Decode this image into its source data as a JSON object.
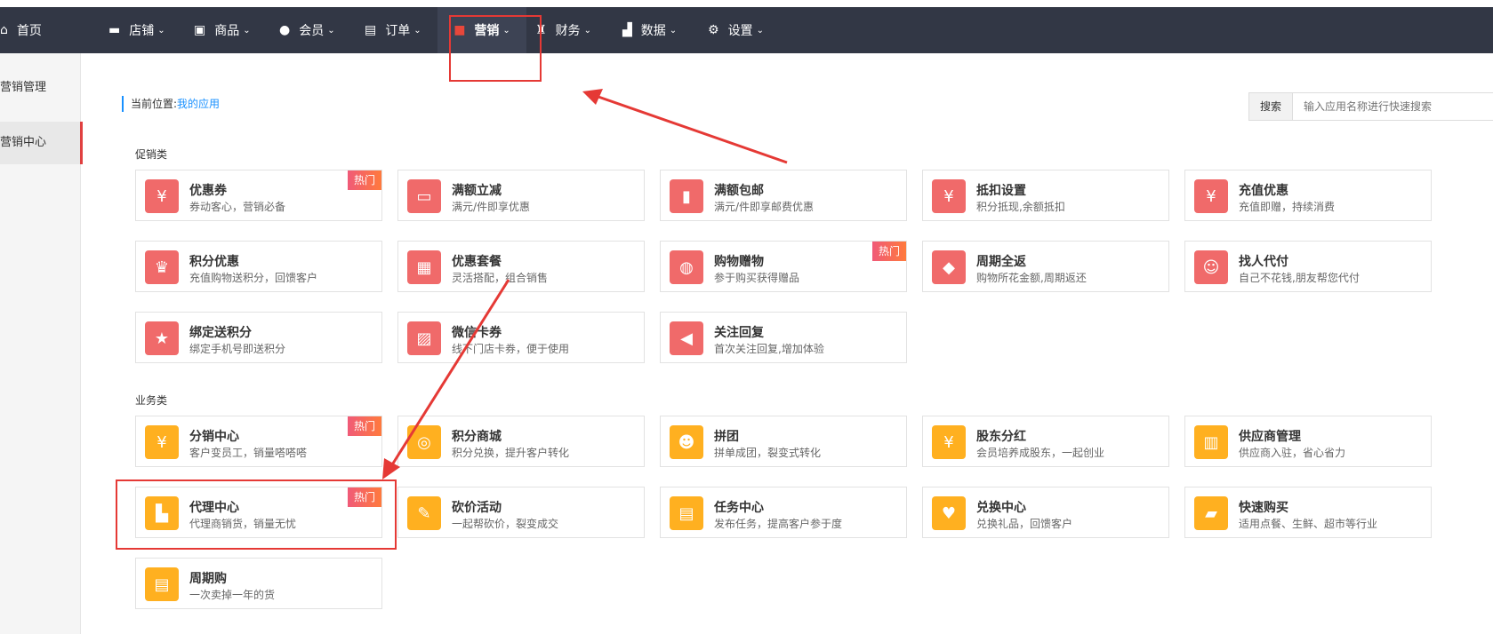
{
  "nav": {
    "items": [
      {
        "label": "首页",
        "icon": "home-icon",
        "glyph": "⌂"
      },
      {
        "label": "店铺",
        "icon": "store-icon",
        "glyph": "▬"
      },
      {
        "label": "商品",
        "icon": "goods-icon",
        "glyph": "▣"
      },
      {
        "label": "会员",
        "icon": "member-icon",
        "glyph": "●"
      },
      {
        "label": "订单",
        "icon": "order-icon",
        "glyph": "▤"
      },
      {
        "label": "营销",
        "icon": "gift-icon",
        "glyph": "■"
      },
      {
        "label": "财务",
        "icon": "finance-icon",
        "glyph": "♜"
      },
      {
        "label": "数据",
        "icon": "chart-icon",
        "glyph": "▟"
      },
      {
        "label": "设置",
        "icon": "gear-icon",
        "glyph": "⚙"
      }
    ]
  },
  "sidebar": {
    "items": [
      {
        "label": "营销管理"
      },
      {
        "label": "营销中心"
      }
    ]
  },
  "breadcrumb": {
    "prefix": "当前位置:",
    "link": "我的应用"
  },
  "search": {
    "label": "搜索",
    "placeholder": "输入应用名称进行快速搜索"
  },
  "sections": {
    "promo": {
      "title": "促销类"
    },
    "business": {
      "title": "业务类"
    }
  },
  "hot_label": "热门",
  "promo_cards": [
    {
      "title": "优惠券",
      "desc": "券动客心，营销必备",
      "hot": true,
      "icon": "coupon-icon",
      "glyph": "¥"
    },
    {
      "title": "满额立减",
      "desc": "满元/件即享优惠",
      "hot": false,
      "icon": "discount-icon",
      "glyph": "▭"
    },
    {
      "title": "满额包邮",
      "desc": "满元/件即享邮费优惠",
      "hot": false,
      "icon": "free-shipping-icon",
      "glyph": "▮"
    },
    {
      "title": "抵扣设置",
      "desc": "积分抵现,余额抵扣",
      "hot": false,
      "icon": "deduct-icon",
      "glyph": "¥"
    },
    {
      "title": "充值优惠",
      "desc": "充值即赠，持续消费",
      "hot": false,
      "icon": "moneybag-icon",
      "glyph": "¥"
    },
    {
      "title": "积分优惠",
      "desc": "充值购物送积分，回馈客户",
      "hot": false,
      "icon": "crown-icon",
      "glyph": "♛"
    },
    {
      "title": "优惠套餐",
      "desc": "灵活搭配，组合销售",
      "hot": false,
      "icon": "package-icon",
      "glyph": "▦"
    },
    {
      "title": "购物赠物",
      "desc": "参于购买获得赠品",
      "hot": true,
      "icon": "shopping-bag-icon",
      "glyph": "◍"
    },
    {
      "title": "周期全返",
      "desc": "购物所花金额,周期返还",
      "hot": false,
      "icon": "diamond-icon",
      "glyph": "◆"
    },
    {
      "title": "找人代付",
      "desc": "自己不花钱,朋友帮您代付",
      "hot": false,
      "icon": "pay-for-icon",
      "glyph": "☺"
    },
    {
      "title": "绑定送积分",
      "desc": "绑定手机号即送积分",
      "hot": false,
      "icon": "bind-icon",
      "glyph": "★"
    },
    {
      "title": "微信卡券",
      "desc": "线下门店卡券，便于使用",
      "hot": false,
      "icon": "card-icon",
      "glyph": "▨"
    },
    {
      "title": "关注回复",
      "desc": "首次关注回复,增加体验",
      "hot": false,
      "icon": "megaphone-icon",
      "glyph": "◀"
    }
  ],
  "business_cards": [
    {
      "title": "分销中心",
      "desc": "客户变员工，销量嗒嗒嗒",
      "hot": true,
      "icon": "distribution-icon",
      "glyph": "¥"
    },
    {
      "title": "积分商城",
      "desc": "积分兑换，提升客户转化",
      "hot": false,
      "icon": "coins-icon",
      "glyph": "◎"
    },
    {
      "title": "拼团",
      "desc": "拼单成团，裂变式转化",
      "hot": false,
      "icon": "group-icon",
      "glyph": "☻"
    },
    {
      "title": "股东分红",
      "desc": "会员培养成股东，一起创业",
      "hot": false,
      "icon": "dividend-icon",
      "glyph": "¥"
    },
    {
      "title": "供应商管理",
      "desc": "供应商入驻，省心省力",
      "hot": false,
      "icon": "building-icon",
      "glyph": "▥"
    },
    {
      "title": "代理中心",
      "desc": "代理商销货，销量无忧",
      "hot": true,
      "icon": "agent-icon",
      "glyph": "▙"
    },
    {
      "title": "砍价活动",
      "desc": "一起帮砍价，裂变成交",
      "hot": false,
      "icon": "bargain-icon",
      "glyph": "✎"
    },
    {
      "title": "任务中心",
      "desc": "发布任务，提高客户参于度",
      "hot": false,
      "icon": "task-icon",
      "glyph": "▤"
    },
    {
      "title": "兑换中心",
      "desc": "兑换礼品，回馈客户",
      "hot": false,
      "icon": "exchange-icon",
      "glyph": "♥"
    },
    {
      "title": "快速购买",
      "desc": "适用点餐、生鲜、超市等行业",
      "hot": false,
      "icon": "wallet-icon",
      "glyph": "▰"
    },
    {
      "title": "周期购",
      "desc": "一次卖掉一年的货",
      "hot": false,
      "icon": "calendar-icon",
      "glyph": "▤"
    }
  ]
}
